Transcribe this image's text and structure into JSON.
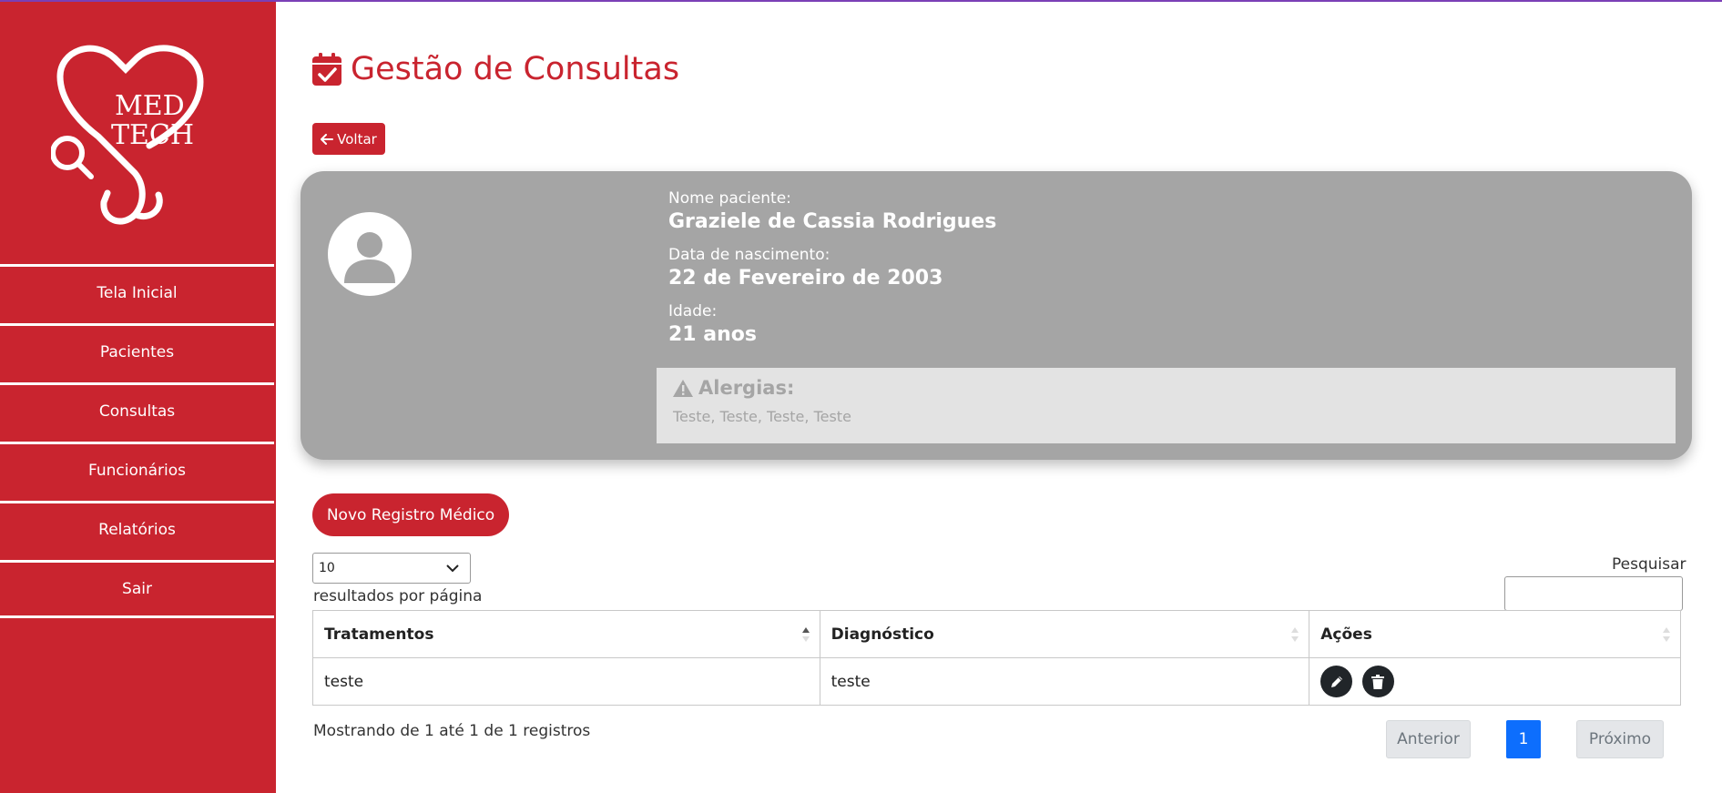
{
  "app": {
    "logo_text_line1": "MED",
    "logo_text_line2": "TECH",
    "accent_color": "#c9242f"
  },
  "sidebar": {
    "items": [
      {
        "label": "Tela Inicial"
      },
      {
        "label": "Pacientes"
      },
      {
        "label": "Consultas"
      },
      {
        "label": "Funcionários"
      },
      {
        "label": "Relatórios"
      },
      {
        "label": "Sair"
      }
    ]
  },
  "header": {
    "title": "Gestão de Consultas",
    "title_icon": "calendar-check-icon",
    "back_label": "Voltar",
    "back_icon": "arrow-left-icon"
  },
  "patient": {
    "name_label": "Nome paciente:",
    "name": "Graziele de Cassia Rodrigues",
    "birth_label": "Data de nascimento:",
    "birth": "22 de Fevereiro de 2003",
    "age_label": "Idade:",
    "age": "21 anos",
    "allergy_title": "Alergias:",
    "allergy_icon": "warning-triangle-icon",
    "allergies": "Teste, Teste, Teste, Teste"
  },
  "records": {
    "new_button_label": "Novo Registro Médico",
    "page_size": "10",
    "page_size_label": "resultados por página",
    "search_label": "Pesquisar",
    "search_value": "",
    "columns": [
      "Tratamentos",
      "Diagnóstico",
      "Ações"
    ],
    "rows": [
      {
        "treatment": "teste",
        "diagnosis": "teste"
      }
    ],
    "action_icons": [
      "pencil-icon",
      "trash-icon"
    ],
    "summary": "Mostrando de 1 até 1 de 1 registros",
    "pagination": {
      "prev": "Anterior",
      "current": "1",
      "next": "Próximo"
    }
  }
}
